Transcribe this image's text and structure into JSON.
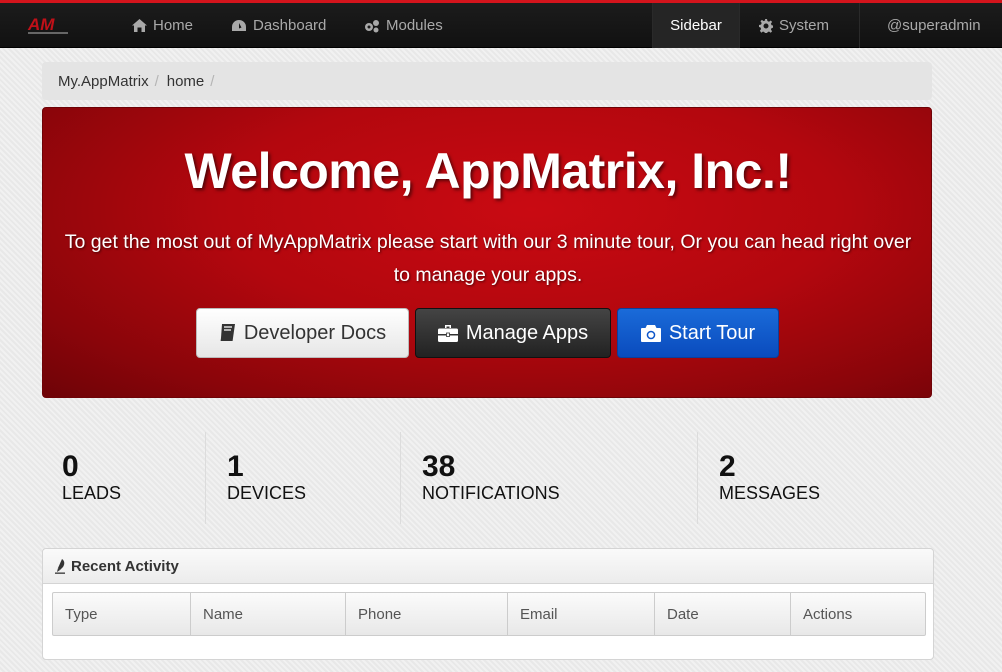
{
  "navbar": {
    "brand": "AM",
    "home": "Home",
    "dashboard": "Dashboard",
    "modules": "Modules",
    "sidebar": "Sidebar",
    "system": "System",
    "user": "@superadmin",
    "accent": "#d3141c"
  },
  "breadcrumb": [
    "My.AppMatrix",
    "home"
  ],
  "hero": {
    "title": "Welcome, AppMatrix, Inc.!",
    "subtitle_line1": "To get the most out of MyAppMatrix please start with our 3 minute tour, Or you can head right over",
    "subtitle_line2": "to manage your apps.",
    "buttons": {
      "docs": "Developer Docs",
      "apps": "Manage Apps",
      "tour": "Start Tour"
    }
  },
  "stats": [
    {
      "value": "0",
      "label": "LEADS"
    },
    {
      "value": "1",
      "label": "DEVICES"
    },
    {
      "value": "38",
      "label": "NOTIFICATIONS"
    },
    {
      "value": "2",
      "label": "MESSAGES"
    }
  ],
  "activity": {
    "title": "Recent Activity",
    "columns": [
      "Type",
      "Name",
      "Phone",
      "Email",
      "Date",
      "Actions"
    ]
  }
}
